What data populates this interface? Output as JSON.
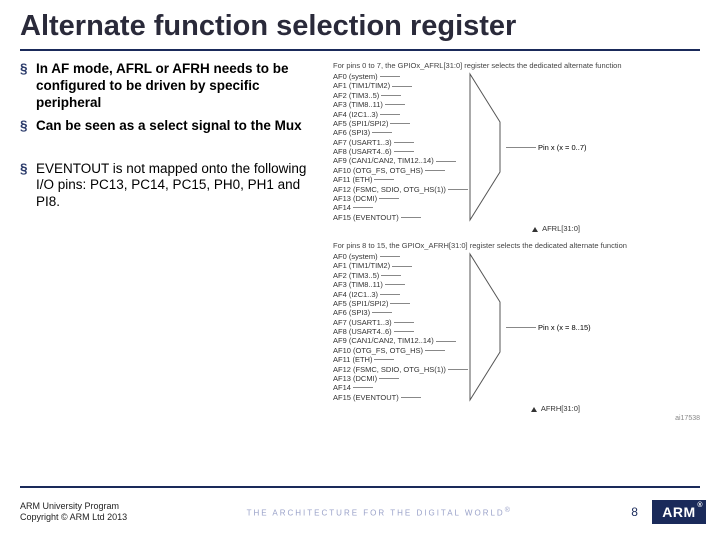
{
  "title": "Alternate function selection register",
  "bullets": {
    "b1": "In AF mode, AFRL or AFRH needs to be configured to be driven by specific peripheral",
    "b2": "Can be seen as a select signal to the Mux",
    "b3": "EVENTOUT is not mapped onto the following I/O pins: PC13, PC14, PC15, PH0, PH1 and PI8."
  },
  "diagrams": {
    "top": {
      "caption": "For pins 0 to 7, the GPIOx_AFRL[31:0] register selects the dedicated alternate function",
      "pin_label": "Pin x (x = 0..7)",
      "sel_label": "AFRL[31:0]",
      "af": [
        "AF0 (system)",
        "AF1 (TIM1/TIM2)",
        "AF2 (TIM3..5)",
        "AF3 (TIM8..11)",
        "AF4 (I2C1..3)",
        "AF5 (SPI1/SPI2)",
        "AF6 (SPI3)",
        "AF7 (USART1..3)",
        "AF8 (USART4..6)",
        "AF9 (CAN1/CAN2, TIM12..14)",
        "AF10 (OTG_FS, OTG_HS)",
        "AF11 (ETH)",
        "AF12 (FSMC, SDIO, OTG_HS(1))",
        "AF13 (DCMI)",
        "AF14",
        "AF15 (EVENTOUT)"
      ]
    },
    "bottom": {
      "caption": "For pins 8 to 15, the GPIOx_AFRH[31:0] register selects the dedicated alternate function",
      "pin_label": "Pin x (x = 8..15)",
      "sel_label": "AFRH[31:0]",
      "doc_id": "ai17538",
      "af": [
        "AF0 (system)",
        "AF1 (TIM1/TIM2)",
        "AF2 (TIM3..5)",
        "AF3 (TIM8..11)",
        "AF4 (I2C1..3)",
        "AF5 (SPI1/SPI2)",
        "AF6 (SPI3)",
        "AF7 (USART1..3)",
        "AF8 (USART4..6)",
        "AF9 (CAN1/CAN2, TIM12..14)",
        "AF10 (OTG_FS, OTG_HS)",
        "AF11 (ETH)",
        "AF12 (FSMC, SDIO, OTG_HS(1))",
        "AF13 (DCMI)",
        "AF14",
        "AF15 (EVENTOUT)"
      ]
    }
  },
  "footer": {
    "line1": "ARM University Program",
    "line2": "Copyright © ARM Ltd 2013",
    "tagline": "THE ARCHITECTURE FOR THE DIGITAL WORLD",
    "page": "8",
    "logo_text": "ARM"
  }
}
